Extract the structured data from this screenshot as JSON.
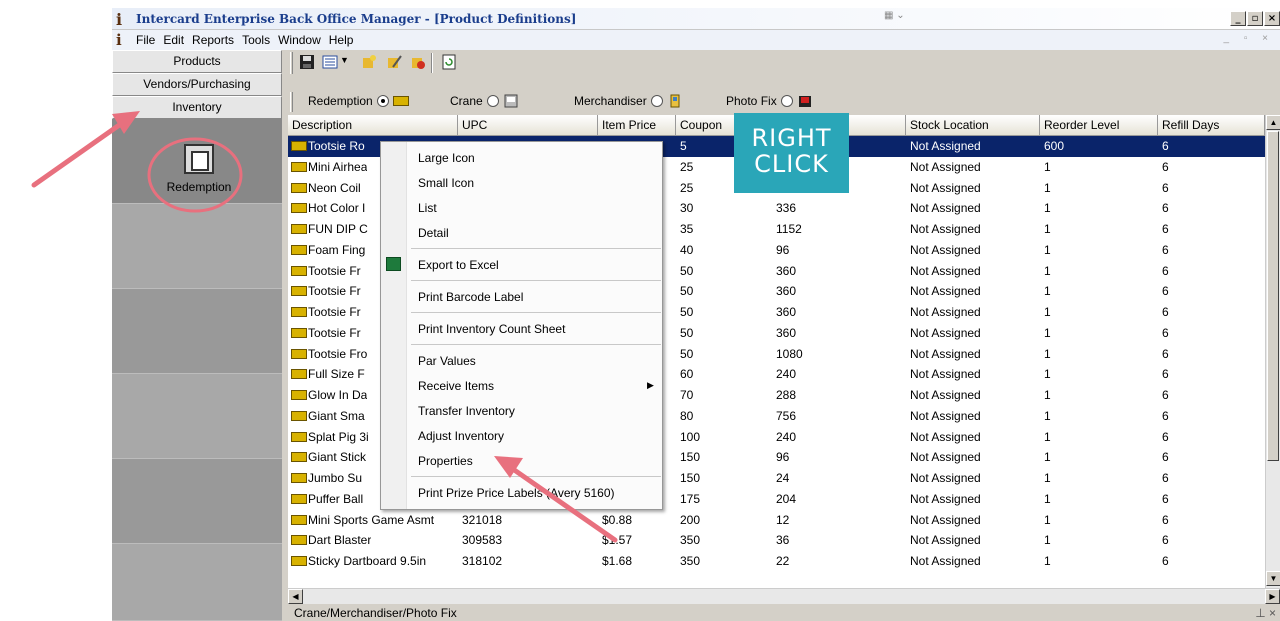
{
  "window": {
    "title": "Intercard Enterprise Back Office Manager - [Product Definitions]",
    "app_icon": "info-i-icon"
  },
  "menubar": {
    "items": [
      "File",
      "Edit",
      "Reports",
      "Tools",
      "Window",
      "Help"
    ]
  },
  "sidebar": {
    "buttons": [
      "Products",
      "Vendors/Purchasing",
      "Inventory"
    ],
    "tile_label": "Redemption"
  },
  "toolbar": {
    "icons": [
      "save-icon",
      "view-options-icon",
      "dropdown-arrow-icon",
      "add-product-icon",
      "edit-product-icon",
      "delete-product-icon",
      "refresh-icon"
    ]
  },
  "type_filter": {
    "options": [
      {
        "label": "Redemption",
        "selected": true,
        "icon": "ticket-icon"
      },
      {
        "label": "Crane",
        "selected": false,
        "icon": "crane-icon"
      },
      {
        "label": "Merchandiser",
        "selected": false,
        "icon": "merchandiser-icon"
      },
      {
        "label": "Photo Fix",
        "selected": false,
        "icon": "photo-fix-icon"
      }
    ]
  },
  "grid": {
    "columns": [
      "Description",
      "UPC",
      "Item Price",
      "Coupon",
      "",
      "Stock Location",
      "Reorder Level",
      "Refill Days"
    ],
    "rows": [
      {
        "desc": "Tootsie Ro",
        "upc": "",
        "price": "",
        "coupons": "5",
        "qty": "",
        "location": "Not Assigned",
        "reorder": "600",
        "refill": "6",
        "selected": true
      },
      {
        "desc": "Mini Airhea",
        "upc": "",
        "price": "",
        "coupons": "25",
        "qty": "",
        "location": "Not Assigned",
        "reorder": "1",
        "refill": "6"
      },
      {
        "desc": "Neon Coil",
        "upc": "",
        "price": "",
        "coupons": "25",
        "qty": "",
        "location": "Not Assigned",
        "reorder": "1",
        "refill": "6"
      },
      {
        "desc": "Hot Color I",
        "upc": "",
        "price": "",
        "coupons": "30",
        "qty": "336",
        "location": "Not Assigned",
        "reorder": "1",
        "refill": "6"
      },
      {
        "desc": "FUN DIP C",
        "upc": "",
        "price": "",
        "coupons": "35",
        "qty": "1152",
        "location": "Not Assigned",
        "reorder": "1",
        "refill": "6"
      },
      {
        "desc": "Foam Fing",
        "upc": "",
        "price": "",
        "coupons": "40",
        "qty": "96",
        "location": "Not Assigned",
        "reorder": "1",
        "refill": "6"
      },
      {
        "desc": "Tootsie Fr",
        "upc": "",
        "price": "",
        "coupons": "50",
        "qty": "360",
        "location": "Not Assigned",
        "reorder": "1",
        "refill": "6"
      },
      {
        "desc": "Tootsie Fr",
        "upc": "",
        "price": "",
        "coupons": "50",
        "qty": "360",
        "location": "Not Assigned",
        "reorder": "1",
        "refill": "6"
      },
      {
        "desc": "Tootsie Fr",
        "upc": "",
        "price": "",
        "coupons": "50",
        "qty": "360",
        "location": "Not Assigned",
        "reorder": "1",
        "refill": "6"
      },
      {
        "desc": "Tootsie Fr",
        "upc": "",
        "price": "",
        "coupons": "50",
        "qty": "360",
        "location": "Not Assigned",
        "reorder": "1",
        "refill": "6"
      },
      {
        "desc": "Tootsie Fro",
        "upc": "",
        "price": "",
        "coupons": "50",
        "qty": "1080",
        "location": "Not Assigned",
        "reorder": "1",
        "refill": "6"
      },
      {
        "desc": "Full Size F",
        "upc": "",
        "price": "",
        "coupons": "60",
        "qty": "240",
        "location": "Not Assigned",
        "reorder": "1",
        "refill": "6"
      },
      {
        "desc": "Glow In Da",
        "upc": "",
        "price": "",
        "coupons": "70",
        "qty": "288",
        "location": "Not Assigned",
        "reorder": "1",
        "refill": "6"
      },
      {
        "desc": "Giant Sma",
        "upc": "",
        "price": "",
        "coupons": "80",
        "qty": "756",
        "location": "Not Assigned",
        "reorder": "1",
        "refill": "6"
      },
      {
        "desc": "Splat Pig 3i",
        "upc": "",
        "price": "",
        "coupons": "100",
        "qty": "240",
        "location": "Not Assigned",
        "reorder": "1",
        "refill": "6"
      },
      {
        "desc": "Giant Stick",
        "upc": "",
        "price": "",
        "coupons": "150",
        "qty": "96",
        "location": "Not Assigned",
        "reorder": "1",
        "refill": "6"
      },
      {
        "desc": "Jumbo Su",
        "upc": "",
        "price": "",
        "coupons": "150",
        "qty": "24",
        "location": "Not Assigned",
        "reorder": "1",
        "refill": "6"
      },
      {
        "desc": "Puffer Ball",
        "upc": "",
        "price": "",
        "coupons": "175",
        "qty": "204",
        "location": "Not Assigned",
        "reorder": "1",
        "refill": "6"
      },
      {
        "desc": "Mini Sports Game Asmt",
        "upc": "321018",
        "price": "$0.88",
        "coupons": "200",
        "qty": "12",
        "location": "Not Assigned",
        "reorder": "1",
        "refill": "6"
      },
      {
        "desc": "Dart Blaster",
        "upc": "309583",
        "price": "$1.57",
        "coupons": "350",
        "qty": "36",
        "location": "Not Assigned",
        "reorder": "1",
        "refill": "6"
      },
      {
        "desc": "Sticky Dartboard 9.5in",
        "upc": "318102",
        "price": "$1.68",
        "coupons": "350",
        "qty": "22",
        "location": "Not Assigned",
        "reorder": "1",
        "refill": "6"
      }
    ]
  },
  "context_menu": {
    "items": [
      {
        "label": "Large Icon"
      },
      {
        "label": "Small Icon"
      },
      {
        "label": "List"
      },
      {
        "label": "Detail",
        "sep_after": true
      },
      {
        "label": "Export to Excel",
        "icon": "excel-icon",
        "sep_after": true
      },
      {
        "label": "Print Barcode Label",
        "sep_after": true
      },
      {
        "label": "Print Inventory Count Sheet",
        "sep_after": true
      },
      {
        "label": "Par Values"
      },
      {
        "label": "Receive Items",
        "submenu": true
      },
      {
        "label": "Transfer Inventory"
      },
      {
        "label": "Adjust Inventory"
      },
      {
        "label": "Properties",
        "sep_after": true
      },
      {
        "label": "Print Prize Price Labels (Avery 5160)"
      }
    ]
  },
  "callout": {
    "line1": "RIGHT",
    "line2": "CLICK",
    "color": "#2aa6b8"
  },
  "annotation_color": "#e8707e",
  "statusbar": {
    "text": "Crane/Merchandiser/Photo Fix"
  }
}
